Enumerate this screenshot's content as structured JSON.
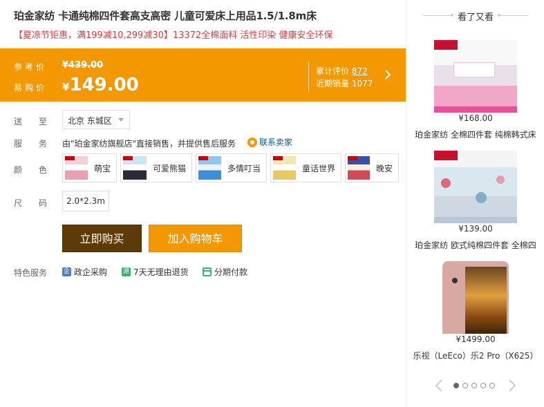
{
  "product": {
    "title": "珀金家纺 卡通纯棉四件套高支高密 儿童可爱床上用品1.5/1.8m床",
    "promo": "【夏凉节钜惠，满199减10,299减30】13372全棉面料 活性印染 健康安全环保"
  },
  "price": {
    "ref_label": "参考价",
    "ref_value": "¥439.00",
    "buy_label": "易购价",
    "buy_currency": "¥",
    "buy_value": "149.00",
    "reviews_label": "累计评价",
    "reviews_count": "872",
    "sales_label": "近期销量",
    "sales_count": "1077"
  },
  "delivery": {
    "label": "送至",
    "location": "北京 东城区"
  },
  "service": {
    "label": "服务",
    "text": "由\"珀金家纺旗舰店\"直接销售，并提供售后服务",
    "contact": "联系卖家"
  },
  "colors": {
    "label": "颜色",
    "options": [
      "萌宝",
      "可爱熊猫",
      "多情叮当",
      "童话世界",
      "晚安"
    ]
  },
  "size": {
    "label": "尺码",
    "options": [
      "2.0*2.3m"
    ]
  },
  "actions": {
    "buy_now": "立即购买",
    "add_cart": "加入购物车"
  },
  "features": {
    "label": "特色服务",
    "items": [
      {
        "icon": "企",
        "text": "政企采购",
        "color": "#4a7fc1"
      },
      {
        "icon": "退",
        "text": "7天无理由退货",
        "color": "#3cb371"
      },
      {
        "icon": "",
        "text": "分期付款",
        "color": "#3cb371"
      }
    ]
  },
  "sidebar": {
    "title": "看了又看",
    "items": [
      {
        "price": "¥168.00",
        "name": "珀金家纺 全棉四件套 纯棉韩式床"
      },
      {
        "price": "¥139.00",
        "name": "珀金家纺 欧式纯棉四件套 全棉四"
      },
      {
        "price": "¥1499.00",
        "name": "乐视（LeEco）乐2 Pro（X625）"
      }
    ],
    "pager_pages": 5,
    "pager_active": 1
  },
  "colors_theme": {
    "accent": "#f39800",
    "buy_button": "#5e3a06",
    "link": "#005ea7",
    "promo": "#e4393c"
  }
}
